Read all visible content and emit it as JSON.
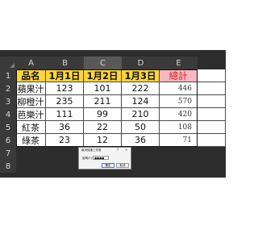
{
  "columns": [
    "A",
    "B",
    "C",
    "D",
    "E"
  ],
  "rows": [
    "1",
    "2",
    "3",
    "4",
    "5",
    "6",
    "7",
    "8"
  ],
  "table": {
    "headers": [
      "品名",
      "1月1日",
      "1月2日",
      "1月3日",
      "總計"
    ],
    "body": [
      [
        "蘋果汁",
        "123",
        "101",
        "222",
        "446"
      ],
      [
        "柳橙汁",
        "235",
        "211",
        "124",
        "570"
      ],
      [
        "芭樂汁",
        "111",
        "99",
        "210",
        "420"
      ],
      [
        "紅茶",
        "36",
        "22",
        "50",
        "108"
      ],
      [
        "綠茶",
        "23",
        "12",
        "36",
        "71"
      ]
    ]
  },
  "dialog": {
    "title": "取消保護工作表",
    "help_label": "?",
    "close_label": "×",
    "password_label": "密碼(P):",
    "password_value": "●●●●",
    "ok_label": "確定",
    "cancel_label": "取消"
  },
  "colors": {
    "header_fill": "#ffd43b",
    "total_header_fill": "#f7b8c1",
    "total_header_text": "#dd2222",
    "sheet_background": "#2d2d2d"
  }
}
